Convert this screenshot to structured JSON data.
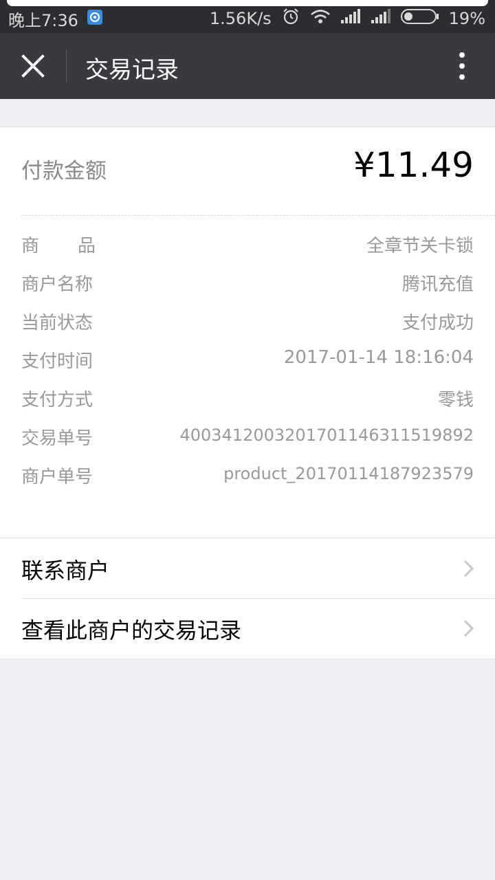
{
  "status_bar": {
    "time": "晚上7:36",
    "network_speed": "1.56K/s",
    "battery": "19%",
    "icons": [
      "notification-icon",
      "alarm-icon",
      "wifi-icon",
      "signal-icon",
      "signal-icon",
      "battery-icon"
    ]
  },
  "nav": {
    "title": "交易记录",
    "icons": [
      "close-icon",
      "more-icon"
    ]
  },
  "payment": {
    "amount_label": "付款金额",
    "amount": "¥11.49"
  },
  "details": [
    {
      "label": "商品",
      "value": "全章节关卡锁"
    },
    {
      "label": "商户名称",
      "value": "腾讯充值"
    },
    {
      "label": "当前状态",
      "value": "支付成功"
    },
    {
      "label": "支付时间",
      "value": "2017-01-14 18:16:04"
    },
    {
      "label": "支付方式",
      "value": "零钱"
    },
    {
      "label": "交易单号",
      "value": "4003412003201701146311519892"
    },
    {
      "label": "商户单号",
      "value": "product_20170114187923579"
    }
  ],
  "menu": [
    {
      "label": "联系商户"
    },
    {
      "label": "查看此商户的交易记录"
    }
  ],
  "colors": {
    "nav_bg": "#393a3f",
    "page_bg": "#efeff4",
    "muted_text": "#999999"
  }
}
